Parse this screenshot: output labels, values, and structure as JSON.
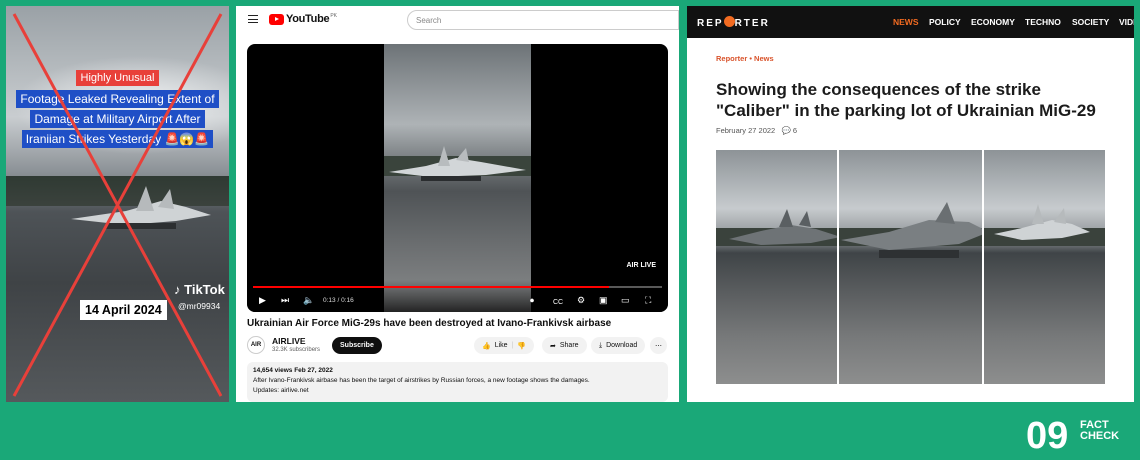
{
  "tiktok": {
    "tag": "Highly Unusual",
    "headline_lines": [
      "Footage Leaked Revealing Extent of",
      "Damage at Military Airport After",
      "Iraniian Strikes Yesterday 🚨😱🚨"
    ],
    "date": "14 April 2024",
    "brand": "TikTok",
    "username": "@mr09934"
  },
  "youtube": {
    "logo_text": "YouTube",
    "logo_country": "PK",
    "search_placeholder": "Search",
    "watermark": "AIR LIVE",
    "time": "0:13 / 0:16",
    "progress": 0.87,
    "video_title": "Ukrainian Air Force MiG-29s have been destroyed at Ivano-Frankivsk airbase",
    "channel": {
      "avatar": "AIR",
      "name": "AIRLIVE",
      "subscribers": "32.3K subscribers"
    },
    "subscribe_label": "Subscribe",
    "like_label": "Like",
    "share_label": "Share",
    "download_label": "Download",
    "description": {
      "stats": "14,654 views  Feb 27, 2022",
      "text": "After Ivano-Frankivsk airbase has been the target of airstrikes by Russian forces, a new footage shows the damages.",
      "updates": "Updates: airlive.net"
    }
  },
  "reporter": {
    "brand_prefix": "REP",
    "brand_suffix": "RTER",
    "nav": [
      "NEWS",
      "POLICY",
      "ECONOMY",
      "TECHNO",
      "SOCIETY",
      "VIDE"
    ],
    "active_nav": "NEWS",
    "breadcrumb": "Reporter • News",
    "title": "Showing the consequences of the strike \"Caliber\" in the parking lot of Ukrainian MiG-29",
    "date": "February 27 2022",
    "comments": "6"
  },
  "logo": {
    "number": "09",
    "line1": "FACT",
    "line2": "CHECK"
  },
  "colors": {
    "background": "#1aa878",
    "cross": "#e8403a",
    "youtube_red": "#ff0000",
    "reporter_orange": "#f26b21"
  }
}
